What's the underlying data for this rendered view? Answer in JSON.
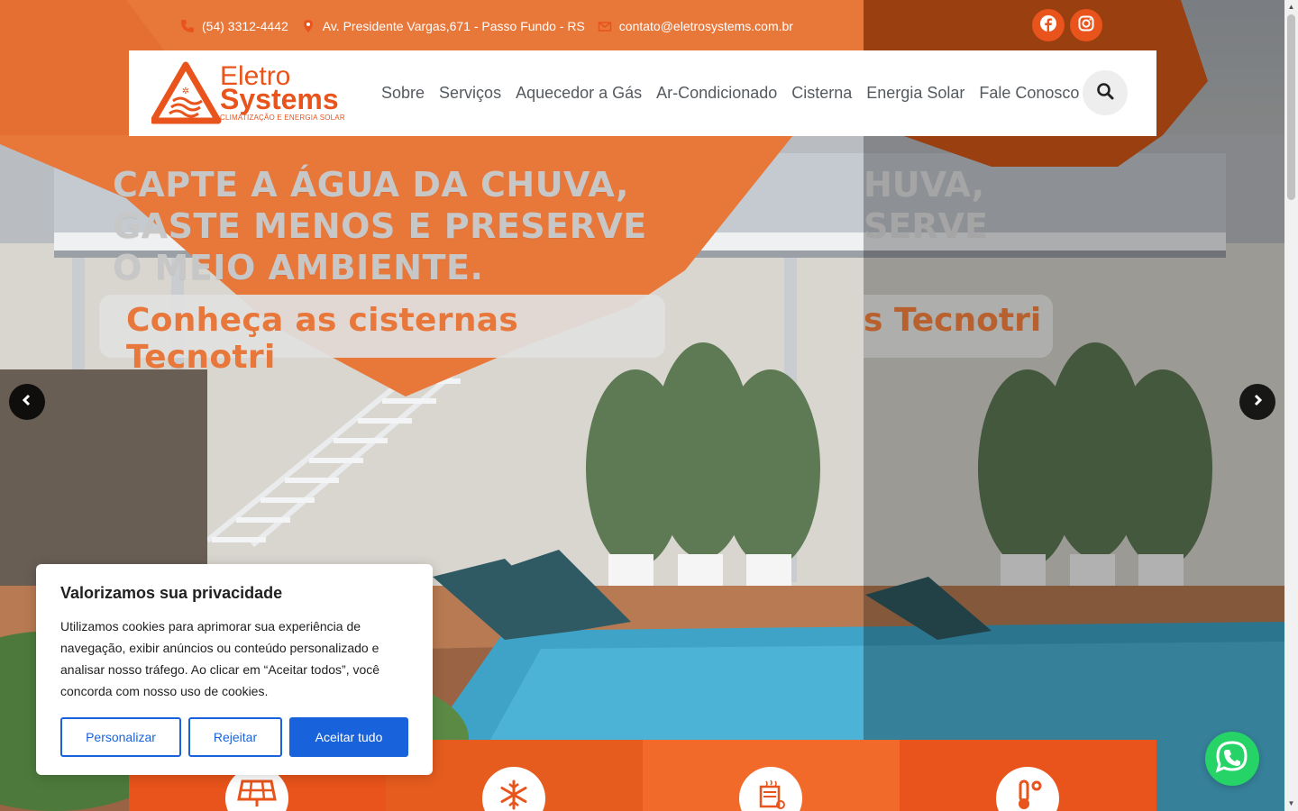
{
  "topbar": {
    "phone": "(54) 3312-4442",
    "address": "Av. Presidente Vargas,671 - Passo Fundo - RS",
    "email": "contato@eletrosystems.com.br"
  },
  "social": {
    "facebook_icon": "facebook-icon",
    "instagram_icon": "instagram-icon"
  },
  "logo": {
    "line1": "Eletro",
    "line2": "Systems",
    "tagline": "CLIMATIZAÇÃO E ENERGIA SOLAR"
  },
  "nav": {
    "items": [
      {
        "label": "Sobre"
      },
      {
        "label": "Serviços"
      },
      {
        "label": "Aquecedor a Gás"
      },
      {
        "label": "Ar-Condicionado"
      },
      {
        "label": "Cisterna"
      },
      {
        "label": "Energia Solar"
      },
      {
        "label": "Fale Conosco"
      }
    ]
  },
  "hero": {
    "headline_line1": "CAPTE A ÁGUA DA CHUVA,",
    "headline_line2": "GASTE MENOS E PRESERVE",
    "headline_line3": "O MEIO AMBIENTE.",
    "subheadline": "Conheça as cisternas Tecnotri",
    "dup_line1": "HUVA,",
    "dup_line2": "SERVE",
    "dup_sub": "s Tecnotri"
  },
  "services": [
    {
      "icon": "solar-panel-icon",
      "color": "#e8541b"
    },
    {
      "icon": "snowflake-icon",
      "color": "#e65c1f"
    },
    {
      "icon": "water-heater-icon",
      "color": "#f26a2a"
    },
    {
      "icon": "thermometer-icon",
      "color": "#e8541b"
    }
  ],
  "cookie": {
    "title": "Valorizamos sua privacidade",
    "text": "Utilizamos cookies para aprimorar sua experiência de navegação, exibir anúncios ou conteúdo personalizado e analisar nosso tráfego. Ao clicar em “Aceitar todos”, você concorda com nosso uso de cookies.",
    "customize": "Personalizar",
    "reject": "Rejeitar",
    "accept": "Aceitar tudo"
  },
  "colors": {
    "brand": "#e8541b",
    "cookie_blue": "#1863dc",
    "whatsapp": "#25d366"
  }
}
